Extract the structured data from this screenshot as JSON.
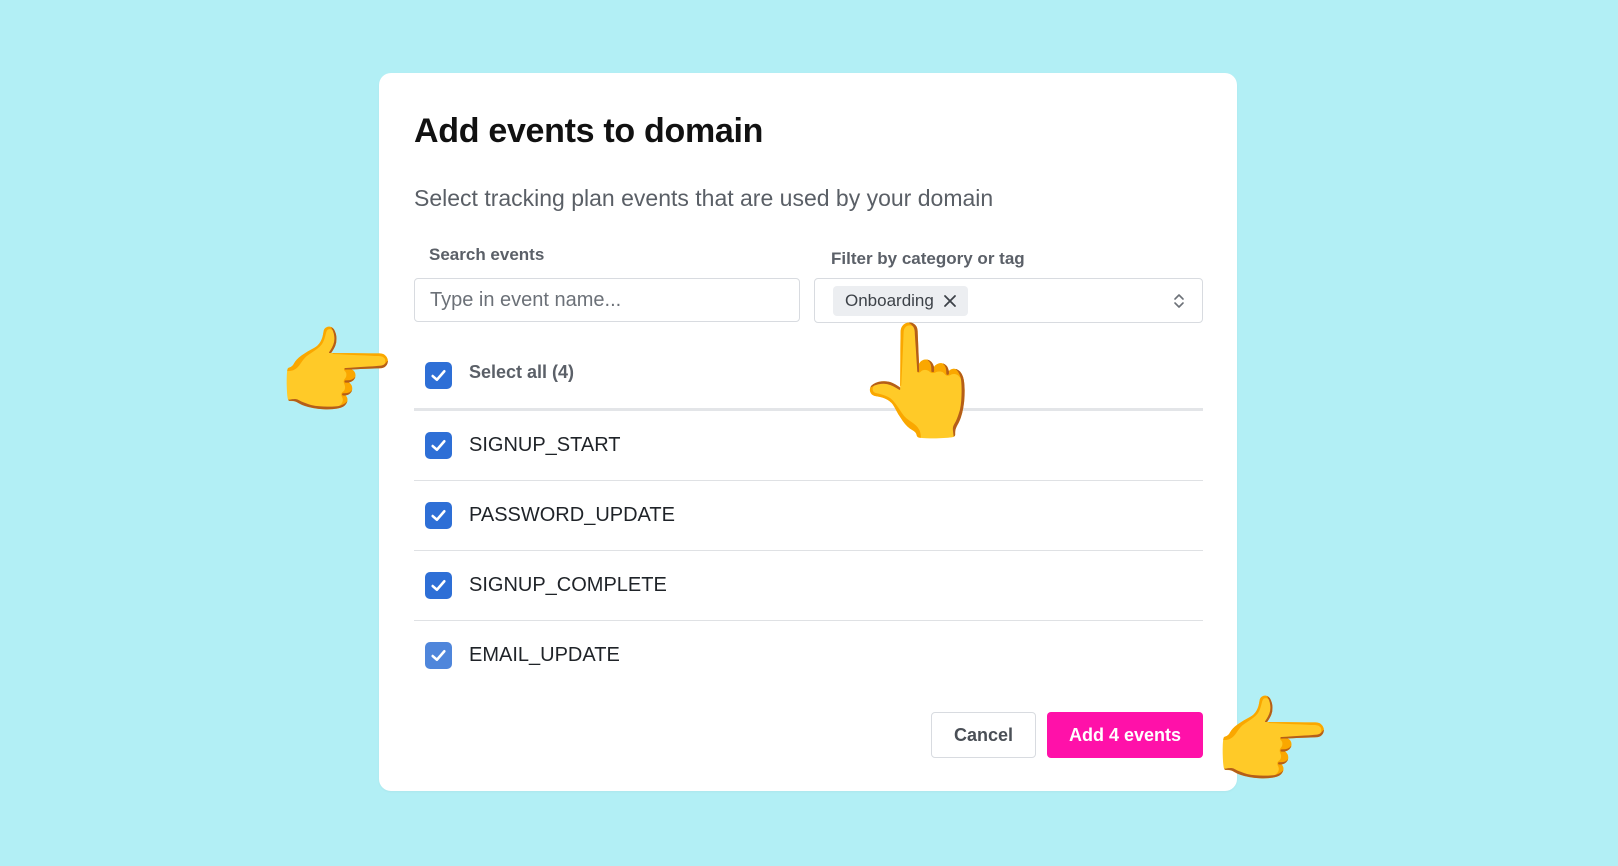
{
  "modal": {
    "title": "Add events to domain",
    "subtitle": "Select tracking plan events that are used by your domain"
  },
  "search": {
    "label": "Search events",
    "placeholder": "Type in event name...",
    "value": ""
  },
  "filter": {
    "label": "Filter by category or tag",
    "selected_tag": "Onboarding"
  },
  "select_all": {
    "label": "Select all (4)",
    "checked": true
  },
  "events": [
    {
      "name": "SIGNUP_START",
      "checked": true
    },
    {
      "name": "PASSWORD_UPDATE",
      "checked": true
    },
    {
      "name": "SIGNUP_COMPLETE",
      "checked": true
    },
    {
      "name": "EMAIL_UPDATE",
      "checked": true
    }
  ],
  "actions": {
    "cancel_label": "Cancel",
    "add_label": "Add 4 events"
  },
  "annotations": {
    "hand_left": "👉",
    "hand_up": "👆",
    "hand_right": "👉"
  },
  "colors": {
    "background": "#b2eff5",
    "checkbox": "#2e6fd6",
    "primary_button": "#ff11a9"
  }
}
